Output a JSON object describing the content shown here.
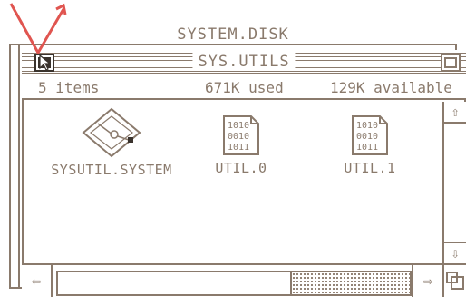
{
  "outer_window": {
    "title": "SYSTEM.DISK"
  },
  "window": {
    "title": "SYS.UTILS",
    "info": {
      "items": "5 items",
      "used": "671K used",
      "available": "129K available"
    }
  },
  "icons": [
    {
      "label": "SYSUTIL.SYSTEM",
      "icon": "system-diamond-icon"
    },
    {
      "label": "UTIL.0",
      "icon": "binary-file-icon",
      "glyph_rows": [
        "1010",
        "0010",
        "1011"
      ]
    },
    {
      "label": "UTIL.1",
      "icon": "binary-file-icon",
      "glyph_rows": [
        "1010",
        "0010",
        "1011"
      ]
    }
  ],
  "scroll": {
    "up": "⇧",
    "down": "⇩",
    "left": "⇦",
    "right": "⇨"
  },
  "colors": {
    "ink": "#8a7a6c",
    "dark": "#3a332d",
    "pointer": "#e05550"
  }
}
